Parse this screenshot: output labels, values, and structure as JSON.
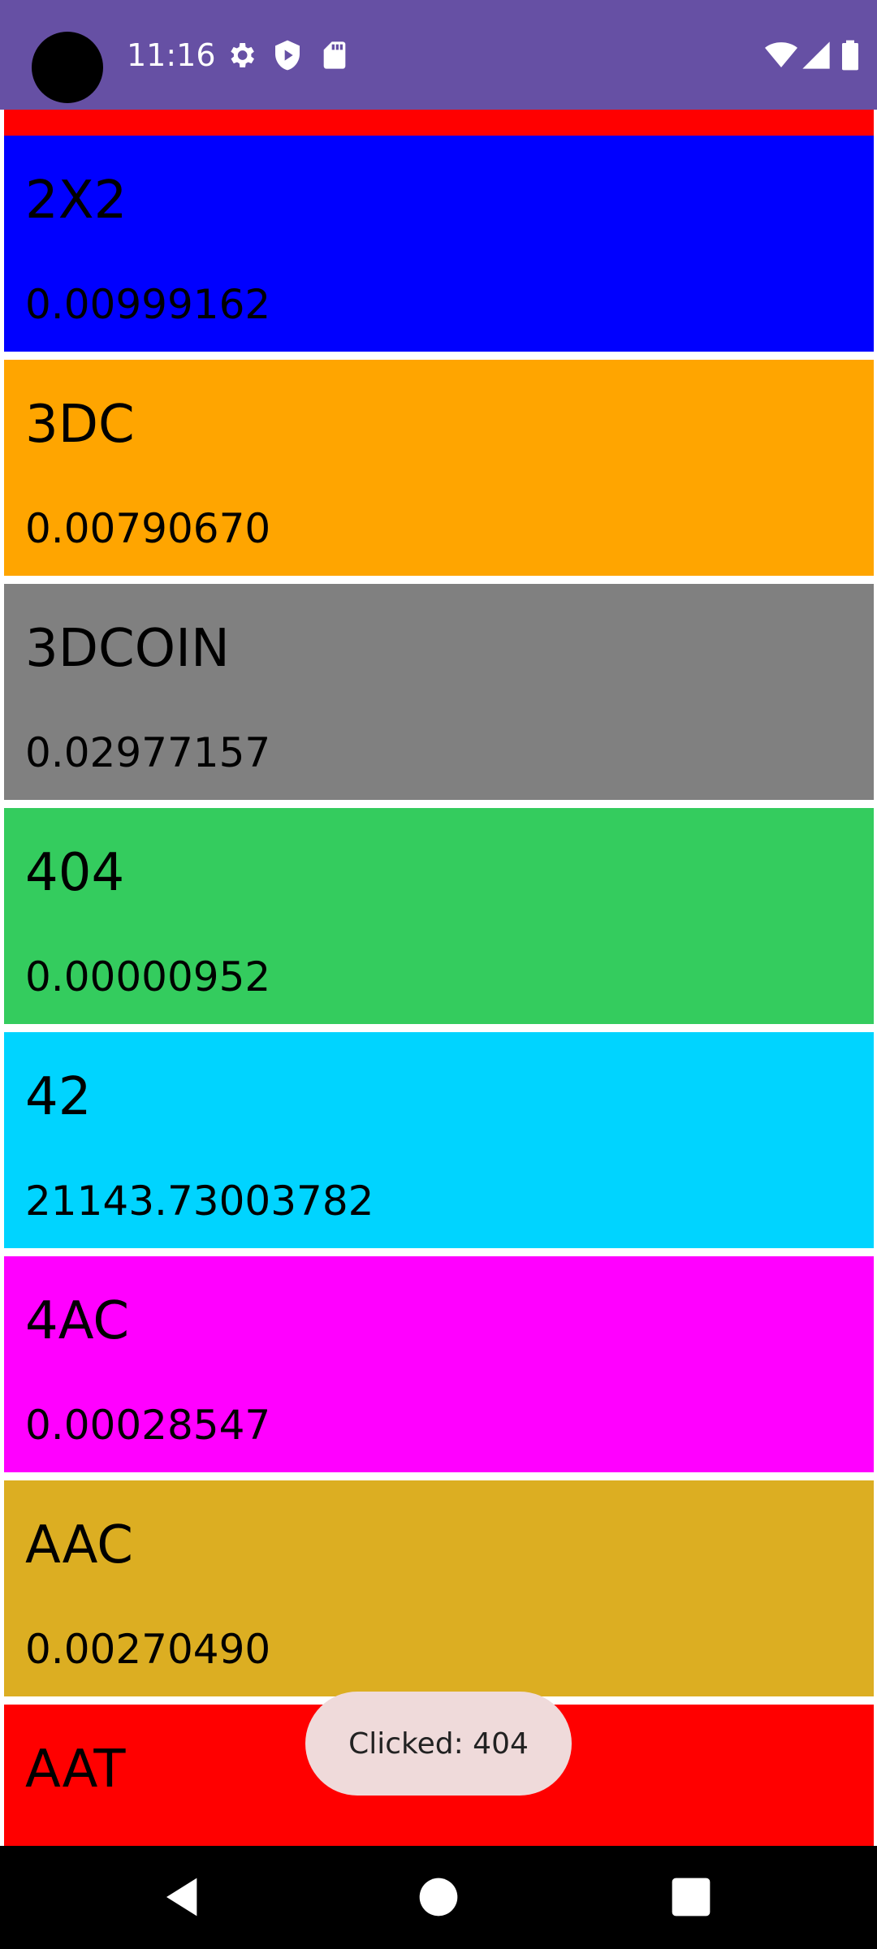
{
  "status_bar": {
    "time": "11:16",
    "background": "#6650a4",
    "left_icons": [
      "gear-icon",
      "shield-play-icon",
      "sd-card-icon"
    ],
    "right_icons": [
      "wifi-icon",
      "cell-signal-icon",
      "battery-icon"
    ]
  },
  "list": {
    "items": [
      {
        "symbol": "",
        "price": "",
        "color": "#ff0000"
      },
      {
        "symbol": "2X2",
        "price": "0.00999162",
        "color": "#0000ff"
      },
      {
        "symbol": "3DC",
        "price": "0.00790670",
        "color": "#ffa500"
      },
      {
        "symbol": "3DCOIN",
        "price": "0.02977157",
        "color": "#808080"
      },
      {
        "symbol": "404",
        "price": "0.00000952",
        "color": "#34cc5e"
      },
      {
        "symbol": "42",
        "price": "21143.73003782",
        "color": "#00d4ff"
      },
      {
        "symbol": "4AC",
        "price": "0.00028547",
        "color": "#ff00ff"
      },
      {
        "symbol": "AAC",
        "price": "0.00270490",
        "color": "#dcae22"
      },
      {
        "symbol": "AAT",
        "price": "",
        "color": "#ff0000"
      }
    ]
  },
  "toast": {
    "text": "Clicked: 404"
  },
  "nav_bar": {
    "icons": [
      "back-icon",
      "home-icon",
      "recents-icon"
    ]
  }
}
